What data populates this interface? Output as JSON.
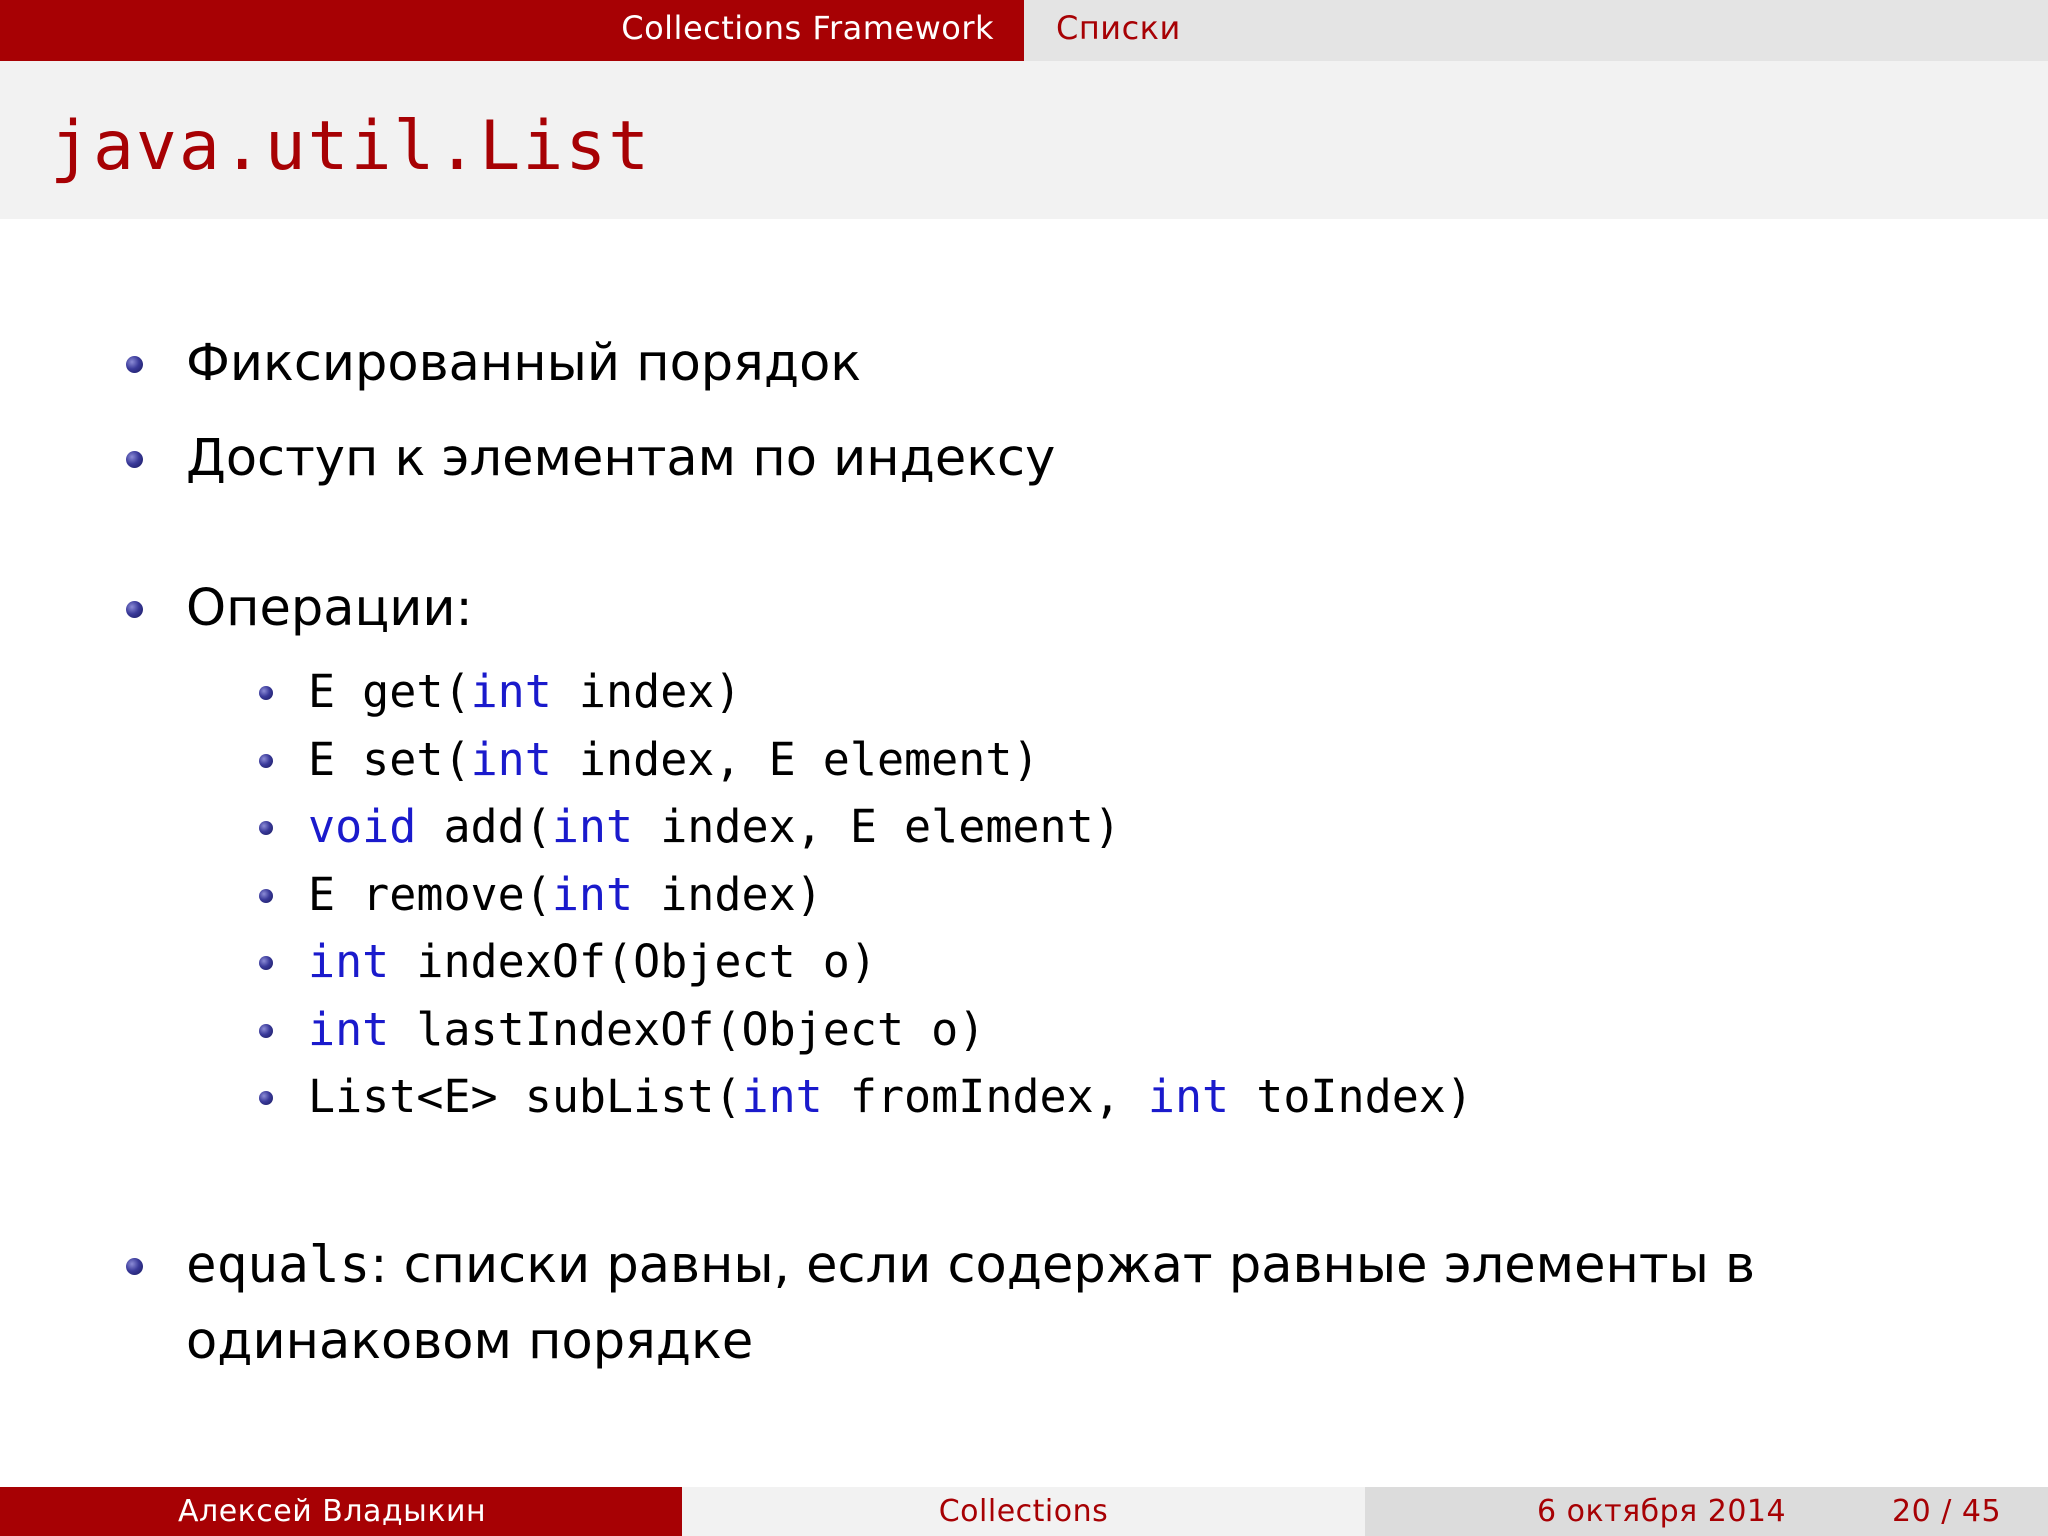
{
  "header": {
    "section": "Collections Framework",
    "subsection": "Списки"
  },
  "title": "java.util.List",
  "bullets": {
    "b1": "Фиксированный порядок",
    "b2": "Доступ к элементам по индексу",
    "b3": "Операции:",
    "b4_code": "equals",
    "b4_rest": ": списки равны, если содержат равные элементы в",
    "b4_cont": "одинаковом порядке"
  },
  "ops": {
    "op1": {
      "a": "E get(",
      "kw1": "int",
      "b": " index)"
    },
    "op2": {
      "a": "E set(",
      "kw1": "int",
      "b": " index, E element)"
    },
    "op3": {
      "kw0": "void",
      "a": " add(",
      "kw1": "int",
      "b": " index, E element)"
    },
    "op4": {
      "a": "E remove(",
      "kw1": "int",
      "b": " index)"
    },
    "op5": {
      "kw0": "int",
      "a": " indexOf(Object o)"
    },
    "op6": {
      "kw0": "int",
      "a": " lastIndexOf(Object o)"
    },
    "op7": {
      "a": "List<E> subList(",
      "kw1": "int",
      "b": " fromIndex, ",
      "kw2": "int",
      "c": " toIndex)"
    }
  },
  "footer": {
    "author": "Алексей Владыкин",
    "topic": "Collections",
    "date": "6 октября 2014",
    "page": "20 / 45"
  },
  "colors": {
    "accent": "#a70104",
    "keyword": "#1a1acc"
  }
}
